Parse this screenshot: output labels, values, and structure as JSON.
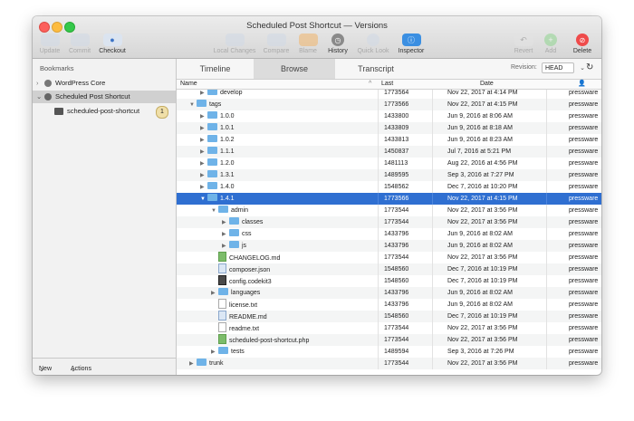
{
  "window": {
    "title": "Scheduled Post Shortcut — Versions"
  },
  "toolbar": {
    "update": "Update",
    "commit": "Commit",
    "checkout": "Checkout",
    "local_changes": "Local Changes",
    "compare": "Compare",
    "blame": "Blame",
    "history": "History",
    "quick_look": "Quick Look",
    "inspector": "Inspector",
    "revert": "Revert",
    "add": "Add",
    "delete": "Delete"
  },
  "sidebar": {
    "header": "Bookmarks",
    "items": [
      {
        "label": "WordPress Core"
      },
      {
        "label": "Scheduled Post Shortcut"
      },
      {
        "label": "scheduled-post-shortcut",
        "badge": "1"
      }
    ],
    "footer": {
      "new": "New",
      "actions": "Actions"
    }
  },
  "tabs": [
    "Timeline",
    "Browse",
    "Transcript"
  ],
  "revision": {
    "label": "Revision:",
    "value": "HEAD"
  },
  "columns": {
    "name": "Name",
    "last": "Last",
    "date": "Date"
  },
  "rows": [
    {
      "name": "develop",
      "last": "1773564",
      "date": "Nov 22, 2017 at 4:14 PM",
      "author": "pressware"
    },
    {
      "name": "tags",
      "last": "1773566",
      "date": "Nov 22, 2017 at 4:15 PM",
      "author": "pressware"
    },
    {
      "name": "1.0.0",
      "last": "1433800",
      "date": "Jun 9, 2016 at 8:06 AM",
      "author": "pressware"
    },
    {
      "name": "1.0.1",
      "last": "1433809",
      "date": "Jun 9, 2016 at 8:18 AM",
      "author": "pressware"
    },
    {
      "name": "1.0.2",
      "last": "1433813",
      "date": "Jun 9, 2016 at 8:23 AM",
      "author": "pressware"
    },
    {
      "name": "1.1.1",
      "last": "1450837",
      "date": "Jul 7, 2016 at 5:21 PM",
      "author": "pressware"
    },
    {
      "name": "1.2.0",
      "last": "1481113",
      "date": "Aug 22, 2016 at 4:56 PM",
      "author": "pressware"
    },
    {
      "name": "1.3.1",
      "last": "1489595",
      "date": "Sep 3, 2016 at 7:27 PM",
      "author": "pressware"
    },
    {
      "name": "1.4.0",
      "last": "1548562",
      "date": "Dec 7, 2016 at 10:20 PM",
      "author": "pressware"
    },
    {
      "name": "1.4.1",
      "last": "1773566",
      "date": "Nov 22, 2017 at 4:15 PM",
      "author": "pressware"
    },
    {
      "name": "admin",
      "last": "1773544",
      "date": "Nov 22, 2017 at 3:56 PM",
      "author": "pressware"
    },
    {
      "name": "classes",
      "last": "1773544",
      "date": "Nov 22, 2017 at 3:56 PM",
      "author": "pressware"
    },
    {
      "name": "css",
      "last": "1433796",
      "date": "Jun 9, 2016 at 8:02 AM",
      "author": "pressware"
    },
    {
      "name": "js",
      "last": "1433796",
      "date": "Jun 9, 2016 at 8:02 AM",
      "author": "pressware"
    },
    {
      "name": "CHANGELOG.md",
      "last": "1773544",
      "date": "Nov 22, 2017 at 3:56 PM",
      "author": "pressware"
    },
    {
      "name": "composer.json",
      "last": "1548560",
      "date": "Dec 7, 2016 at 10:19 PM",
      "author": "pressware"
    },
    {
      "name": "config.codekit3",
      "last": "1548560",
      "date": "Dec 7, 2016 at 10:19 PM",
      "author": "pressware"
    },
    {
      "name": "languages",
      "last": "1433796",
      "date": "Jun 9, 2016 at 8:02 AM",
      "author": "pressware"
    },
    {
      "name": "license.txt",
      "last": "1433796",
      "date": "Jun 9, 2016 at 8:02 AM",
      "author": "pressware"
    },
    {
      "name": "README.md",
      "last": "1548560",
      "date": "Dec 7, 2016 at 10:19 PM",
      "author": "pressware"
    },
    {
      "name": "readme.txt",
      "last": "1773544",
      "date": "Nov 22, 2017 at 3:56 PM",
      "author": "pressware"
    },
    {
      "name": "scheduled-post-shortcut.php",
      "last": "1773544",
      "date": "Nov 22, 2017 at 3:56 PM",
      "author": "pressware"
    },
    {
      "name": "tests",
      "last": "1489594",
      "date": "Sep 3, 2016 at 7:26 PM",
      "author": "pressware"
    },
    {
      "name": "trunk",
      "last": "1773544",
      "date": "Nov 22, 2017 at 3:56 PM",
      "author": "pressware"
    }
  ],
  "colors": {
    "selection": "#2f6fd1",
    "folder": "#6fb3e8",
    "accent_red": "#ef4b4b"
  }
}
